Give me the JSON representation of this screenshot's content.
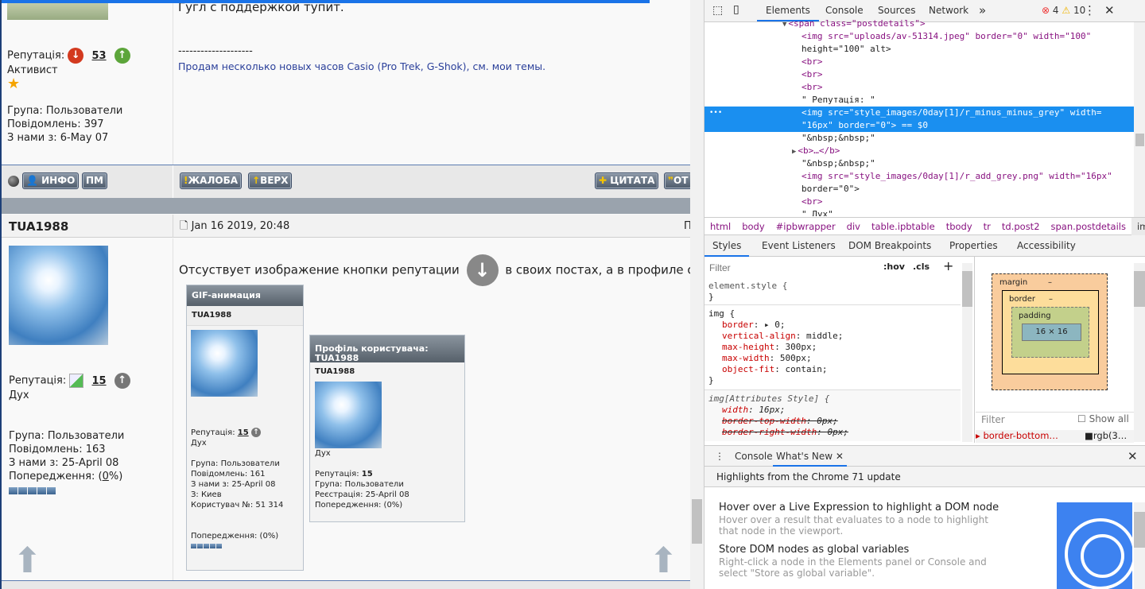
{
  "post1": {
    "reputation_label": "Репутація:",
    "reputation_value": "53",
    "rank": "Активист",
    "group": "Група: Пользователи",
    "posts": "Повідомлень: 397",
    "joined": "З нами з: 6-May 07",
    "body_text": "Гугл с поддержкой тупит.",
    "signature_sep": "--------------------",
    "signature": "Продам несколько новых часов Casio (Pro Trek, G-Shok), см. мои темы.",
    "buttons": {
      "info": "ИНФО",
      "pm": "ПМ",
      "report": "ЖАЛОБА",
      "top": "ВЕРХ",
      "quote": "ЦИТАТА",
      "reply": "ОТ"
    }
  },
  "post2": {
    "username": "TUA1988",
    "date": "Jan 16 2019, 20:48",
    "header_right": "П",
    "reputation_label": "Репутація:",
    "reputation_value": "15",
    "rank": "Дух",
    "group": "Група: Пользователи",
    "posts": "Повідомлень: 163",
    "joined": "З нами з: 25-April 08",
    "warnings_label": "Попередження: (",
    "warnings_value": "0",
    "warnings_end": "%)",
    "body_text": "Отсуствует изображение кнопки репутации",
    "body_text2": "в своих постах, а в профиле он",
    "shot1": {
      "title": "GIF-анимация",
      "username": "TUA1988",
      "rep_label": "Репутація:",
      "rep_value": "15",
      "rank": "Дух",
      "group": "Група: Пользователи",
      "posts": "Повідомлень: 161",
      "joined": "З нами з: 25-April 08",
      "city": "З: Киев",
      "user_no": "Користувач №: 51 314",
      "warnings": "Попередження: (0%)"
    },
    "shot2": {
      "title": "Профіль користувача: TUA1988",
      "username": "TUA1988",
      "rank": "Дух",
      "rep_label": "Репутація:",
      "rep_value": "15",
      "group": "Група: Пользователи",
      "registered": "Реєстрація: 25-April 08",
      "warnings": "Попередження: (0%)"
    }
  },
  "devtools": {
    "tabs": [
      "Elements",
      "Console",
      "Sources",
      "Network"
    ],
    "more": "»",
    "errors": "4",
    "warnings": "10",
    "dom": [
      {
        "text": "<span class=\"postdetails\">"
      },
      {
        "text": "<img src=\"uploads/av-51314.jpeg\" border=\"0\" width=\"100\""
      },
      {
        "text": "height=\"100\" alt>"
      },
      {
        "text": "<br>"
      },
      {
        "text": "<br>"
      },
      {
        "text": "<br>"
      },
      {
        "text": "\" Репутація: \""
      },
      {
        "text": "<img src=\"style_images/0day[1]/r_minus_minus_grey\" width="
      },
      {
        "text": "\"16px\" border=\"0\"> == $0"
      },
      {
        "text": "\"&nbsp;&nbsp;\""
      },
      {
        "text": "<b>…</b>"
      },
      {
        "text": "\"&nbsp;&nbsp;\""
      },
      {
        "text": "<img src=\"style_images/0day[1]/r_add_grey.png\" width=\"16px\""
      },
      {
        "text": "border=\"0\">"
      },
      {
        "text": "<br>"
      },
      {
        "text": "\"                    Дух\""
      }
    ],
    "breadcrumb": [
      "html",
      "body",
      "#ipbwrapper",
      "div",
      "table.ipbtable",
      "tbody",
      "tr",
      "td.post2",
      "span.postdetails",
      "img"
    ],
    "sub_tabs": [
      "Styles",
      "Event Listeners",
      "DOM Breakpoints",
      "Properties",
      "Accessibility"
    ],
    "filter_placeholder": "Filter",
    "hov": ":hov",
    "cls": ".cls",
    "plus": "+",
    "rules": {
      "element_style": "element.style {",
      "close": "}",
      "img_sel": "img {",
      "img_props": [
        [
          "border",
          "▸ 0;"
        ],
        [
          "vertical-align",
          "middle;"
        ],
        [
          "max-height",
          "300px;"
        ],
        [
          "max-width",
          "500px;"
        ],
        [
          "object-fit",
          "contain;"
        ]
      ],
      "attr_sel": "img[Attributes Style] {",
      "attr_props": [
        [
          "width",
          "16px;",
          false
        ],
        [
          "border-top-width",
          "0px;",
          true
        ],
        [
          "border-right-width",
          "0px;",
          true
        ]
      ]
    },
    "boxmodel": {
      "margin": "margin",
      "border": "border",
      "padding": "padding",
      "dash": "–",
      "content": "16 × 16"
    },
    "computed_filter": "Filter",
    "show_all": "Show all",
    "computed_prop": "border-bottom…",
    "computed_val": "rgb(3…",
    "drawer_tabs": [
      "Console",
      "What's New"
    ],
    "highlights": "Highlights from the Chrome 71 update",
    "news": [
      {
        "title": "Hover over a Live Expression to highlight a DOM node",
        "desc": "Hover over a result that evaluates to a node to highlight that node in the viewport."
      },
      {
        "title": "Store DOM nodes as global variables",
        "desc": "Right-click a node in the Elements panel or Console and select \"Store as global variable\"."
      }
    ]
  },
  "colors": {
    "accent": "#1a73e8",
    "selected_row": "#1a8ff0",
    "rep_down": "#d33a1f",
    "rep_up": "#5ca53a"
  }
}
